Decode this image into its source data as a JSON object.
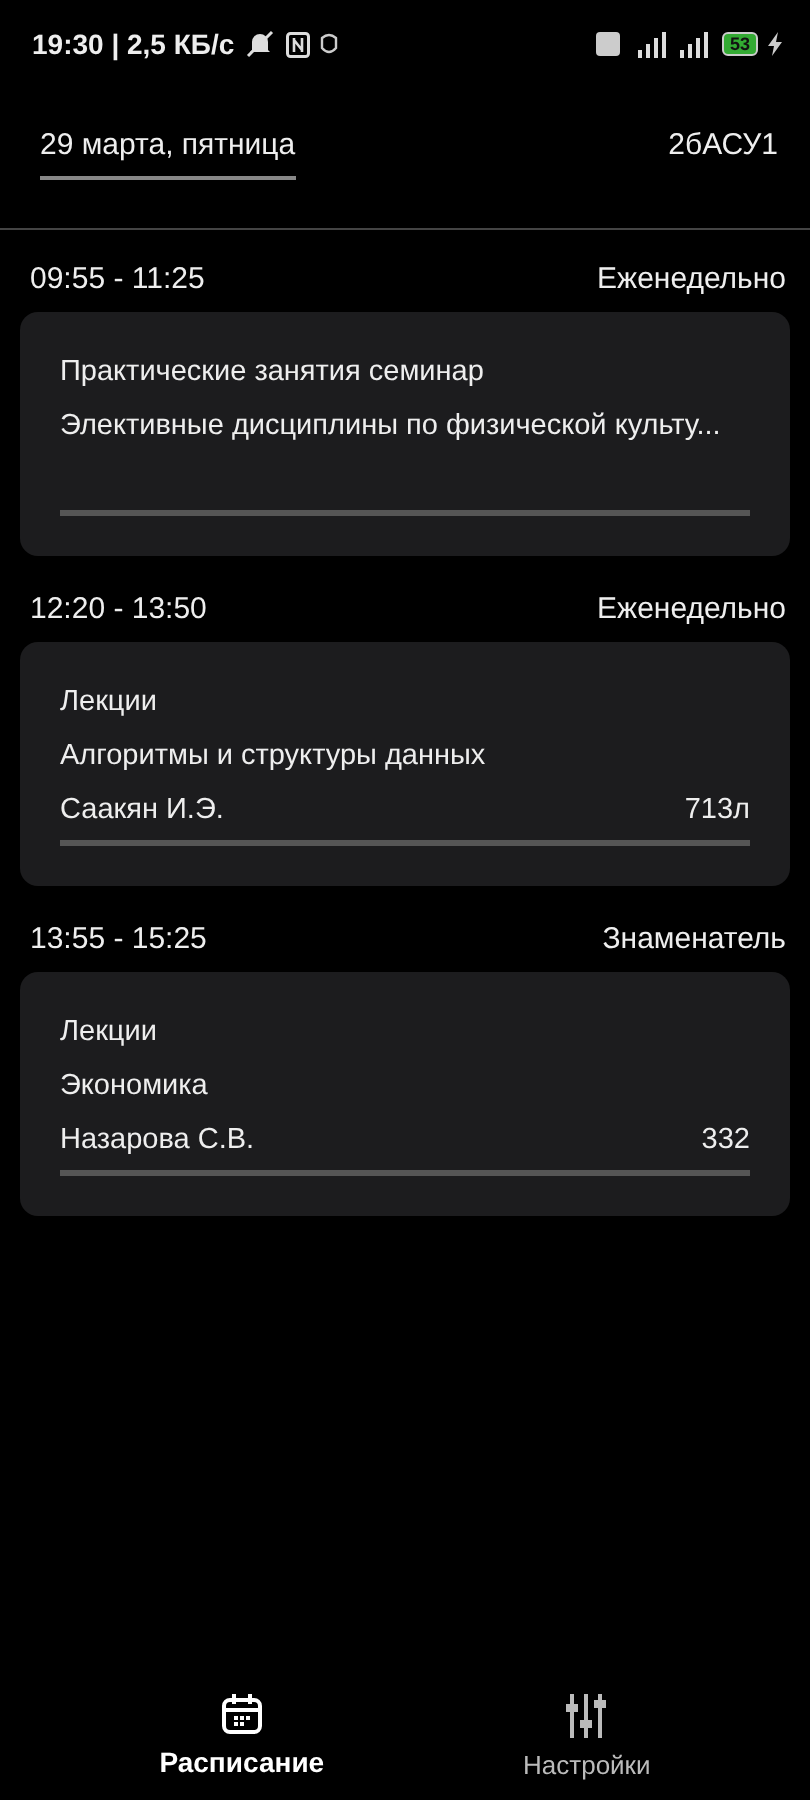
{
  "status_bar": {
    "time": "19:30 | 2,5 КБ/с",
    "battery": "53"
  },
  "header": {
    "date": "29 марта, пятница",
    "group": "2бАСУ1"
  },
  "lessons": [
    {
      "time": "09:55 - 11:25",
      "repeat": "Еженедельно",
      "type": "Практические занятия семинар",
      "subject": "Элективные дисциплины по физической культу..."
    },
    {
      "time": "12:20 - 13:50",
      "repeat": "Еженедельно",
      "type": "Лекции",
      "subject": "Алгоритмы и структуры данных",
      "teacher": "Саакян И.Э.",
      "room": "713л"
    },
    {
      "time": "13:55 - 15:25",
      "repeat": "Знаменатель",
      "type": "Лекции",
      "subject": "Экономика",
      "teacher": "Назарова С.В.",
      "room": "332"
    }
  ],
  "nav": [
    {
      "label": "Расписание",
      "kind": "calendar",
      "selected": true
    },
    {
      "label": "Настройки",
      "kind": "sliders",
      "selected": false
    }
  ]
}
